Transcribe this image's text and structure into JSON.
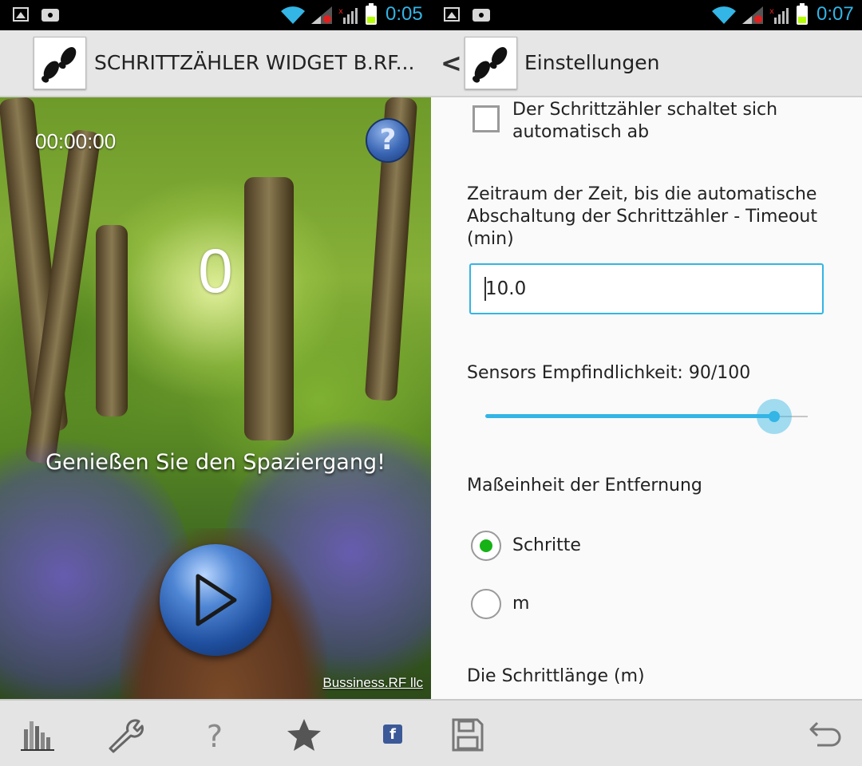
{
  "left_screen": {
    "status_time": "0:05",
    "app_title": "SCHRITTZÄHLER WIDGET B.RF...",
    "timer": "00:00:00",
    "help_label": "?",
    "step_count": "0",
    "motto": "Genießen Sie den Spaziergang!",
    "credit": "Bussiness.RF llc",
    "bottom_icons": [
      "statistics-icon",
      "wrench-icon",
      "help-icon",
      "star-icon",
      "facebook-icon"
    ],
    "facebook_label": "f"
  },
  "right_screen": {
    "status_time": "0:07",
    "back_label": "<",
    "title": "Einstellungen",
    "auto_off": {
      "label": "Der Schrittzähler schaltet sich automatisch ab",
      "checked": false
    },
    "timeout": {
      "label": "Zeitraum der Zeit, bis die automatische Abschaltung der Schrittzähler - Timeout (min)",
      "value": "10.0"
    },
    "sensitivity": {
      "label": "Sensors Empfindlichkeit: 90/100",
      "value": 90,
      "max": 100
    },
    "distance_unit": {
      "label": "Maßeinheit der Entfernung",
      "options": [
        "Schritte",
        "m"
      ],
      "selected": "Schritte"
    },
    "step_length": {
      "label": "Die Schrittlänge (m)"
    },
    "bottom_icons": [
      "save-icon",
      "undo-icon"
    ]
  },
  "colors": {
    "accent": "#33b5e5",
    "radio_selected": "#16b216",
    "status_clock": "#33b5e5"
  }
}
